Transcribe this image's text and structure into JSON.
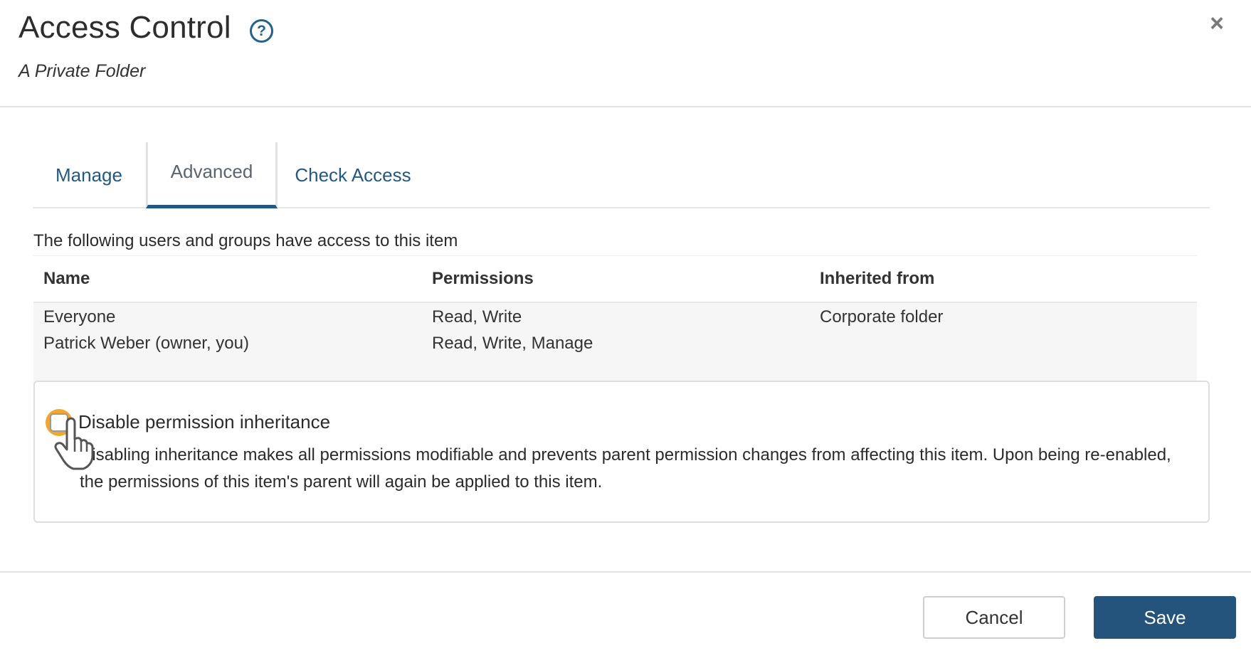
{
  "header": {
    "title": "Access Control",
    "help_icon_glyph": "?",
    "subtitle": "A Private Folder",
    "close_glyph": "×"
  },
  "tabs": [
    {
      "label": "Manage",
      "active": false
    },
    {
      "label": "Advanced",
      "active": true
    },
    {
      "label": "Check Access",
      "active": false
    }
  ],
  "access": {
    "caption": "The following users and groups have access to this item",
    "columns": [
      "Name",
      "Permissions",
      "Inherited from"
    ],
    "rows": [
      {
        "name": "Everyone",
        "permissions": "Read, Write",
        "inherited_from": "Corporate folder"
      },
      {
        "name": "Patrick Weber (owner, you)",
        "permissions": "Read, Write, Manage",
        "inherited_from": ""
      }
    ]
  },
  "inheritance": {
    "checked": false,
    "label": "Disable permission inheritance",
    "description": "Disabling inheritance makes all permissions modifiable and prevents parent permission changes from affecting this item. Upon being re-enabled, the permissions of this item's parent will again be applied to this item."
  },
  "footer": {
    "cancel_label": "Cancel",
    "save_label": "Save"
  },
  "colors": {
    "accent": "#1f5a86",
    "primary_button": "#24547c",
    "checkbox_highlight": "#f5a623"
  },
  "icons": {
    "help": "help-icon",
    "close": "close-icon",
    "cursor": "pointer-hand-icon"
  }
}
